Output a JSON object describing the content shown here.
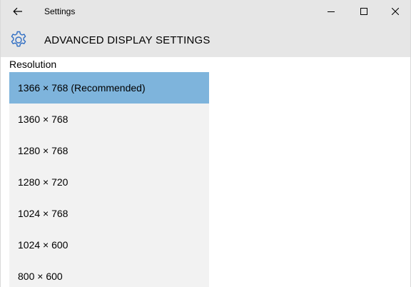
{
  "titlebar": {
    "app_title": "Settings",
    "back_icon": "arrow-left-icon",
    "minimize_icon": "minimize-icon",
    "maximize_icon": "maximize-icon",
    "close_icon": "close-icon"
  },
  "header": {
    "icon": "gear-icon",
    "title": "ADVANCED DISPLAY SETTINGS"
  },
  "resolution": {
    "label": "Resolution",
    "selected": "1366 × 768 (Recommended)",
    "options": [
      "1366 × 768 (Recommended)",
      "1360 × 768",
      "1280 × 768",
      "1280 × 720",
      "1024 × 768",
      "1024 × 600",
      "800 × 600"
    ]
  },
  "colors": {
    "chrome_bg": "#e6e6e6",
    "accent": "#2e6dc3",
    "selected_bg": "#7eb4dc",
    "list_bg": "#f2f2f2"
  }
}
